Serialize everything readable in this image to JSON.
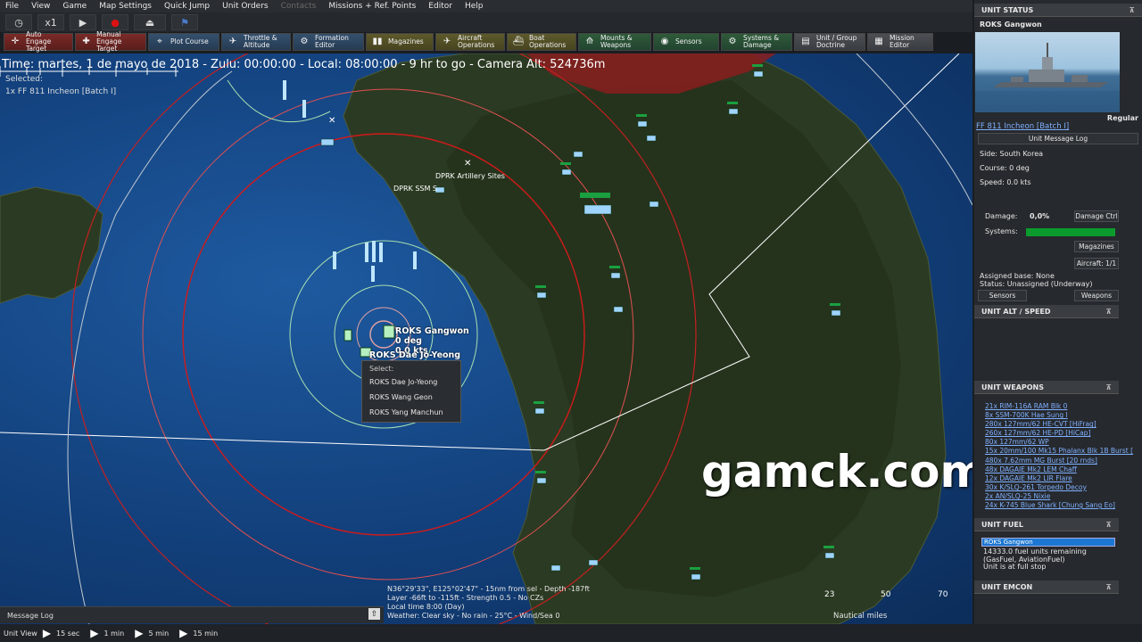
{
  "menu": [
    "File",
    "View",
    "Game",
    "Map Settings",
    "Quick Jump",
    "Unit Orders",
    "Contacts",
    "Missions + Ref. Points",
    "Editor",
    "Help"
  ],
  "timebar": {
    "speed_label": "x1"
  },
  "toolbar": [
    {
      "label": "Auto Engage\nTarget",
      "icon": "auto-engage-icon",
      "color": "red"
    },
    {
      "label": "Manual\nEngage Target",
      "icon": "manual-engage-icon",
      "color": "red"
    },
    {
      "label": "Plot Course",
      "icon": "plot-course-icon",
      "color": "blue"
    },
    {
      "label": "Throttle &\nAltitude",
      "icon": "throttle-icon",
      "color": "blue"
    },
    {
      "label": "Formation\nEditor",
      "icon": "formation-icon",
      "color": "blue"
    },
    {
      "label": "Magazines",
      "icon": "magazines-icon",
      "color": "olive"
    },
    {
      "label": "Aircraft\nOperations",
      "icon": "aircraft-icon",
      "color": "olive"
    },
    {
      "label": "Boat\nOperations",
      "icon": "boat-icon",
      "color": "olive"
    },
    {
      "label": "Mounts &\nWeapons",
      "icon": "mounts-icon",
      "color": "green"
    },
    {
      "label": "Sensors",
      "icon": "sensors-icon",
      "color": "green"
    },
    {
      "label": "Systems &\nDamage",
      "icon": "systems-icon",
      "color": "green"
    },
    {
      "label": "Unit / Group\nDoctrine",
      "icon": "doctrine-icon",
      "color": "gray"
    },
    {
      "label": "Mission\nEditor",
      "icon": "mission-editor-icon",
      "color": "gray"
    }
  ],
  "map": {
    "time_readout": "Time: martes, 1 de mayo de 2018 - Zulu: 00:00:00 - Local: 08:00:00 - 9 hr to go -  Camera Alt: 524736m",
    "selected_label": "Selected:",
    "selected_unit": "1x FF 811 Incheon [Batch I]",
    "labels": {
      "artillery": "DPRK Artillery Sites",
      "ssm": "DPRK SSM S"
    },
    "unit_labels": {
      "name": "ROKS Gangwon",
      "course": "0 deg",
      "speed": "0.0 kts",
      "second": "ROKS Dae Jo-Yeong"
    },
    "context_menu": {
      "title": "Select:",
      "items": [
        "ROKS Dae Jo-Yeong",
        "ROKS Wang Geon",
        "ROKS Yang Manchun"
      ]
    },
    "cursor_info": [
      "N36°29'33\", E125°02'47\" - 15nm from sel - Depth -187ft",
      "Layer -66ft to -115ft - Strength 0.5 - No CZs",
      "Local time 8:00 (Day)",
      "Weather: Clear sky - No rain - 25°C - Wind/Sea 0"
    ],
    "scale": {
      "ticks": [
        "23",
        "50",
        "70"
      ],
      "title": "Nautical miles"
    },
    "watermark": "gamck.com"
  },
  "message_log": {
    "label": "Message Log"
  },
  "bottombar": {
    "label": "Unit View",
    "steps": [
      "15 sec",
      "1 min",
      "5 min",
      "15 min"
    ]
  },
  "panel": {
    "unit_status": {
      "header": "UNIT STATUS",
      "unit_name": "ROKS Gangwon",
      "proficiency": "Regular",
      "class_link": "FF 811 Incheon [Batch I]",
      "message_log_btn": "Unit Message Log",
      "side": "Side: South Korea",
      "course": "Course: 0 deg",
      "speed": "Speed: 0.0 kts",
      "damage_label": "Damage:",
      "damage_value": "0,0%",
      "damage_btn": "Damage Ctrl",
      "systems_label": "Systems:",
      "magazines_btn": "Magazines",
      "aircraft_btn": "Aircraft: 1/1",
      "assigned_base": "Assigned base: None",
      "status": "Status: Unassigned (Underway)",
      "sensors_btn": "Sensors",
      "weapons_btn": "Weapons"
    },
    "alt_speed": {
      "header": "UNIT ALT / SPEED"
    },
    "weapons": {
      "header": "UNIT WEAPONS",
      "items": [
        "21x RIM-116A RAM Blk 0",
        "8x SSM-700K Hae Sung I",
        "280x 127mm/62 HE-CVT [HiFrag]",
        "260x 127mm/62 HE-PD [HiCap]",
        "80x 127mm/62 WP",
        "15x 20mm/100 Mk15 Phalanx Blk 1B Burst [",
        "480x 7.62mm MG Burst [20 rnds]",
        "48x DAGAIE Mk2 LEM Chaff",
        "12x DAGAIE Mk2 LIR Flare",
        "30x K/SLQ-261 Torpedo Decoy",
        "2x AN/SLQ-25 Nixie",
        "24x K-745 Blue Shark [Chung Sang Eo]"
      ]
    },
    "fuel": {
      "header": "UNIT FUEL",
      "bar_label": "ROKS Gangwon",
      "remaining": "14333.0 fuel units remaining",
      "type": "(GasFuel, AviationFuel)",
      "state": "Unit is at full stop"
    },
    "emcon": {
      "header": "UNIT EMCON"
    },
    "collapse_glyph": "⊼"
  },
  "colors": {
    "accent_red": "#d11a1a",
    "systems_green": "#0b9b2c",
    "link_blue": "#7fb0ff"
  }
}
